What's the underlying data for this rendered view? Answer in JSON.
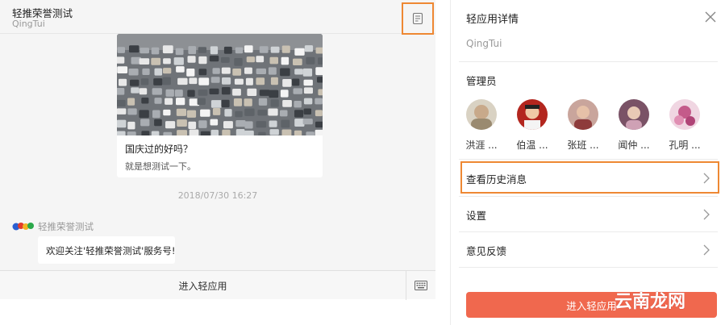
{
  "chat": {
    "title": "轻推荣誉测试",
    "subtitle": "QingTui",
    "detail_icon": "document-icon",
    "article": {
      "title": "国庆过的好吗？",
      "description": "就是想测试一下。"
    },
    "timestamp": "2018/07/30 16:27",
    "sender_name": "轻推荣誉测试",
    "message": "欢迎关注'轻推荣誉测试'服务号!",
    "footer_label": "进入轻应用",
    "keyboard_icon": "keyboard-icon"
  },
  "detail": {
    "title": "轻应用详情",
    "subtitle": "QingTui",
    "admins_label": "管理员",
    "admins": [
      {
        "name": "洪涯 ...",
        "color": "#9a8a70"
      },
      {
        "name": "伯温 ...",
        "color": "#b3261e"
      },
      {
        "name": "张班 ...",
        "color": "#b0706a"
      },
      {
        "name": "闻仲 ...",
        "color": "#8a5a6a"
      },
      {
        "name": "孔明 ...",
        "color": "#c45a8a"
      }
    ],
    "menu": [
      {
        "label": "查看历史消息"
      },
      {
        "label": "设置"
      },
      {
        "label": "意见反馈"
      }
    ],
    "enter_button": "进入轻应用",
    "accent_color": "#f0684e",
    "highlight_color": "#ee8833"
  },
  "watermark": "云南龙网"
}
